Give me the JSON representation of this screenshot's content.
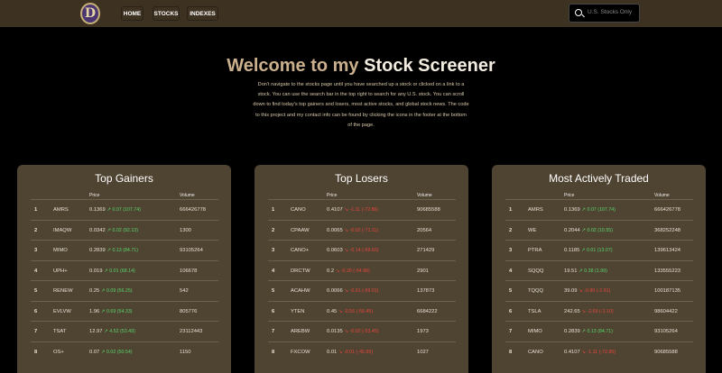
{
  "nav": {
    "logo_letter": "D",
    "home": "HOME",
    "stocks": "STOCKS",
    "indexes": "INDEXES",
    "search_placeholder": "U.S. Stocks Only"
  },
  "hero": {
    "title_plain": "Welcome to my",
    "title_highlight": "Stock Screener",
    "description": "Don't navigate to the stocks page until you have searched up a stock or clicked on a link to a stock. You can use the search bar in the top right to search for any U.S. stock. You can scroll down to find today's top gainers and losers, most active stocks, and global stock news. The code to this project and my contact info can be found by clicking the icons in the footer at the bottom of the page."
  },
  "colors": {
    "accent": "#cbb08d",
    "panel": "#4f4331",
    "gain": "#59d46d",
    "loss": "#e5463f"
  },
  "panels": [
    {
      "title": "Top Gainers",
      "price_label": "Price",
      "volume_label": "Volume",
      "direction": "up",
      "rows": [
        {
          "rank": "1",
          "symbol": "AMRS",
          "price": "0.1369",
          "change": "0.07 (107.74)",
          "volume": "666426778"
        },
        {
          "rank": "2",
          "symbol": "IMAQW",
          "price": "0.0342",
          "change": "0.02 (92.13)",
          "volume": "1300"
        },
        {
          "rank": "3",
          "symbol": "MIMO",
          "price": "0.2839",
          "change": "0.13 (84.71)",
          "volume": "93105264"
        },
        {
          "rank": "4",
          "symbol": "UPH+",
          "price": "0.019",
          "change": "0.01 (68.14)",
          "volume": "106678"
        },
        {
          "rank": "5",
          "symbol": "RENEW",
          "price": "0.25",
          "change": "0.09 (56.25)",
          "volume": "542"
        },
        {
          "rank": "6",
          "symbol": "EVLVW",
          "price": "1.96",
          "change": "0.69 (54.33)",
          "volume": "805776"
        },
        {
          "rank": "7",
          "symbol": "TSAT",
          "price": "12.97",
          "change": "4.52 (53.49)",
          "volume": "23112443"
        },
        {
          "rank": "8",
          "symbol": "OS+",
          "price": "0.07",
          "change": "0.02 (50.54)",
          "volume": "1150"
        }
      ]
    },
    {
      "title": "Top Losers",
      "price_label": "Price",
      "volume_label": "Volume",
      "direction": "down",
      "rows": [
        {
          "rank": "1",
          "symbol": "CANO",
          "price": "0.4107",
          "change": "-1.11 (-72.86)",
          "volume": "90685588"
        },
        {
          "rank": "2",
          "symbol": "CPAAW",
          "price": "0.0065",
          "change": "-0.02 (-71.11)",
          "volume": "20564"
        },
        {
          "rank": "3",
          "symbol": "CANO+",
          "price": "0.0603",
          "change": "-0.14 (-69.60)",
          "volume": "271429"
        },
        {
          "rank": "4",
          "symbol": "DRCTW",
          "price": "0.2",
          "change": "-0.26 (-64.96)",
          "volume": "2901"
        },
        {
          "rank": "5",
          "symbol": "ACAHW",
          "price": "0.0066",
          "change": "-0.01 (-59.01)",
          "volume": "137873"
        },
        {
          "rank": "6",
          "symbol": "YTEN",
          "price": "0.45",
          "change": "-0.56 (-55.45)",
          "volume": "6684222"
        },
        {
          "rank": "7",
          "symbol": "AREBW",
          "price": "0.0135",
          "change": "-0.02 (-53.45)",
          "volume": "1973"
        },
        {
          "rank": "8",
          "symbol": "FXCOW",
          "price": "0.01",
          "change": "-0.01 (-45.95)",
          "volume": "1027"
        }
      ]
    },
    {
      "title": "Most Actively Traded",
      "price_label": "Price",
      "volume_label": "Volume",
      "direction": "mixed",
      "rows": [
        {
          "rank": "1",
          "symbol": "AMRS",
          "price": "0.1369",
          "change": "0.07 (107.74)",
          "dir": "up",
          "volume": "666426778"
        },
        {
          "rank": "2",
          "symbol": "WE",
          "price": "0.2044",
          "change": "0.02 (10.55)",
          "dir": "up",
          "volume": "368252248"
        },
        {
          "rank": "3",
          "symbol": "PTRA",
          "price": "0.1185",
          "change": "0.01 (13.07)",
          "dir": "up",
          "volume": "139613424"
        },
        {
          "rank": "4",
          "symbol": "SQQQ",
          "price": "19.51",
          "change": "0.38 (1.99)",
          "dir": "up",
          "volume": "133555223"
        },
        {
          "rank": "5",
          "symbol": "TQQQ",
          "price": "39.09",
          "change": "-0.80 (-2.01)",
          "dir": "down",
          "volume": "100187135"
        },
        {
          "rank": "6",
          "symbol": "TSLA",
          "price": "242.65",
          "change": "-2.69 (-1.10)",
          "dir": "down",
          "volume": "98604422"
        },
        {
          "rank": "7",
          "symbol": "MIMO",
          "price": "0.2839",
          "change": "0.13 (84.71)",
          "dir": "up",
          "volume": "93105264"
        },
        {
          "rank": "8",
          "symbol": "CANO",
          "price": "0.4107",
          "change": "-1.11 (-72.86)",
          "dir": "down",
          "volume": "90685588"
        }
      ]
    }
  ]
}
